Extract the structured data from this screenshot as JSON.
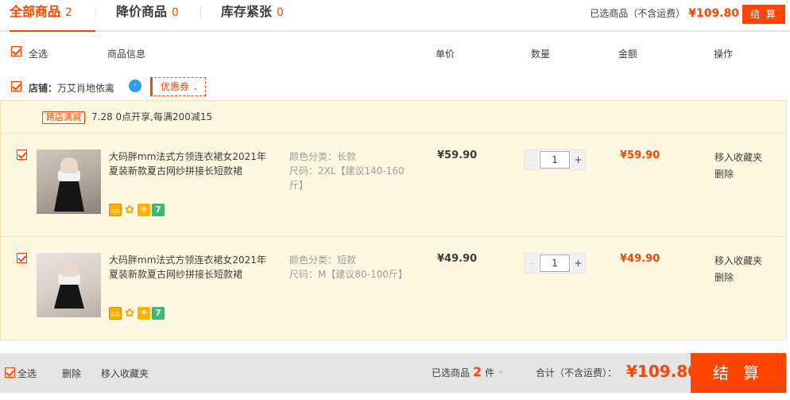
{
  "tabs": [
    {
      "label": "全部商品",
      "count": "2"
    },
    {
      "label": "降价商品",
      "count": "0"
    },
    {
      "label": "库存紧张",
      "count": "0"
    }
  ],
  "summary": {
    "label": "已选商品（不含运费）",
    "price": "¥109.80",
    "pay_label": "结 算"
  },
  "header": {
    "select_all": "全选",
    "info": "商品信息",
    "price": "单价",
    "qty": "数量",
    "amount": "金额",
    "ops": "操作"
  },
  "shop": {
    "prefix": "店铺：",
    "name": "万艾肖地依禽",
    "coupon": "优惠券",
    "ww_text": "ᶜ"
  },
  "promo": {
    "tag": "跨店满减",
    "text": "7.28 0点开享,每满200减15"
  },
  "items": [
    {
      "title": "大码胖mm法式方领连衣裙女2021年夏装新款夏古网纱拼接长短款裙",
      "sku_color": "颜色分类：长款",
      "sku_size": "尺码：2XL【建议140-160斤】",
      "price": "¥59.90",
      "qty": "1",
      "amount": "¥59.90",
      "op_fav": "移入收藏夹",
      "op_del": "删除",
      "qty_minus": "-",
      "qty_plus": "+"
    },
    {
      "title": "大码胖mm法式方领连衣裙女2021年夏装新款夏古网纱拼接长短款裙",
      "sku_color": "颜色分类：短款",
      "sku_size": "尺码：M【建议80-100斤】",
      "price": "¥49.90",
      "qty": "1",
      "amount": "¥49.90",
      "op_fav": "移入收藏夹",
      "op_del": "删除",
      "qty_minus": "-",
      "qty_plus": "+"
    }
  ],
  "badges": {
    "card": "▭",
    "flower": "✿",
    "sun": "☀",
    "seven": "7"
  },
  "bottom": {
    "select_all": "全选",
    "delete": "删除",
    "fav": "移入收藏夹",
    "selected_prefix": "已选商品",
    "selected_count": "2",
    "selected_unit": "件",
    "total_label": "合计（不含运费）：",
    "total": "¥109.80",
    "pay": "结 算",
    "up_arrow": "^"
  },
  "colors": {
    "accent": "#ff4400",
    "row_bg": "#fff8e1"
  }
}
